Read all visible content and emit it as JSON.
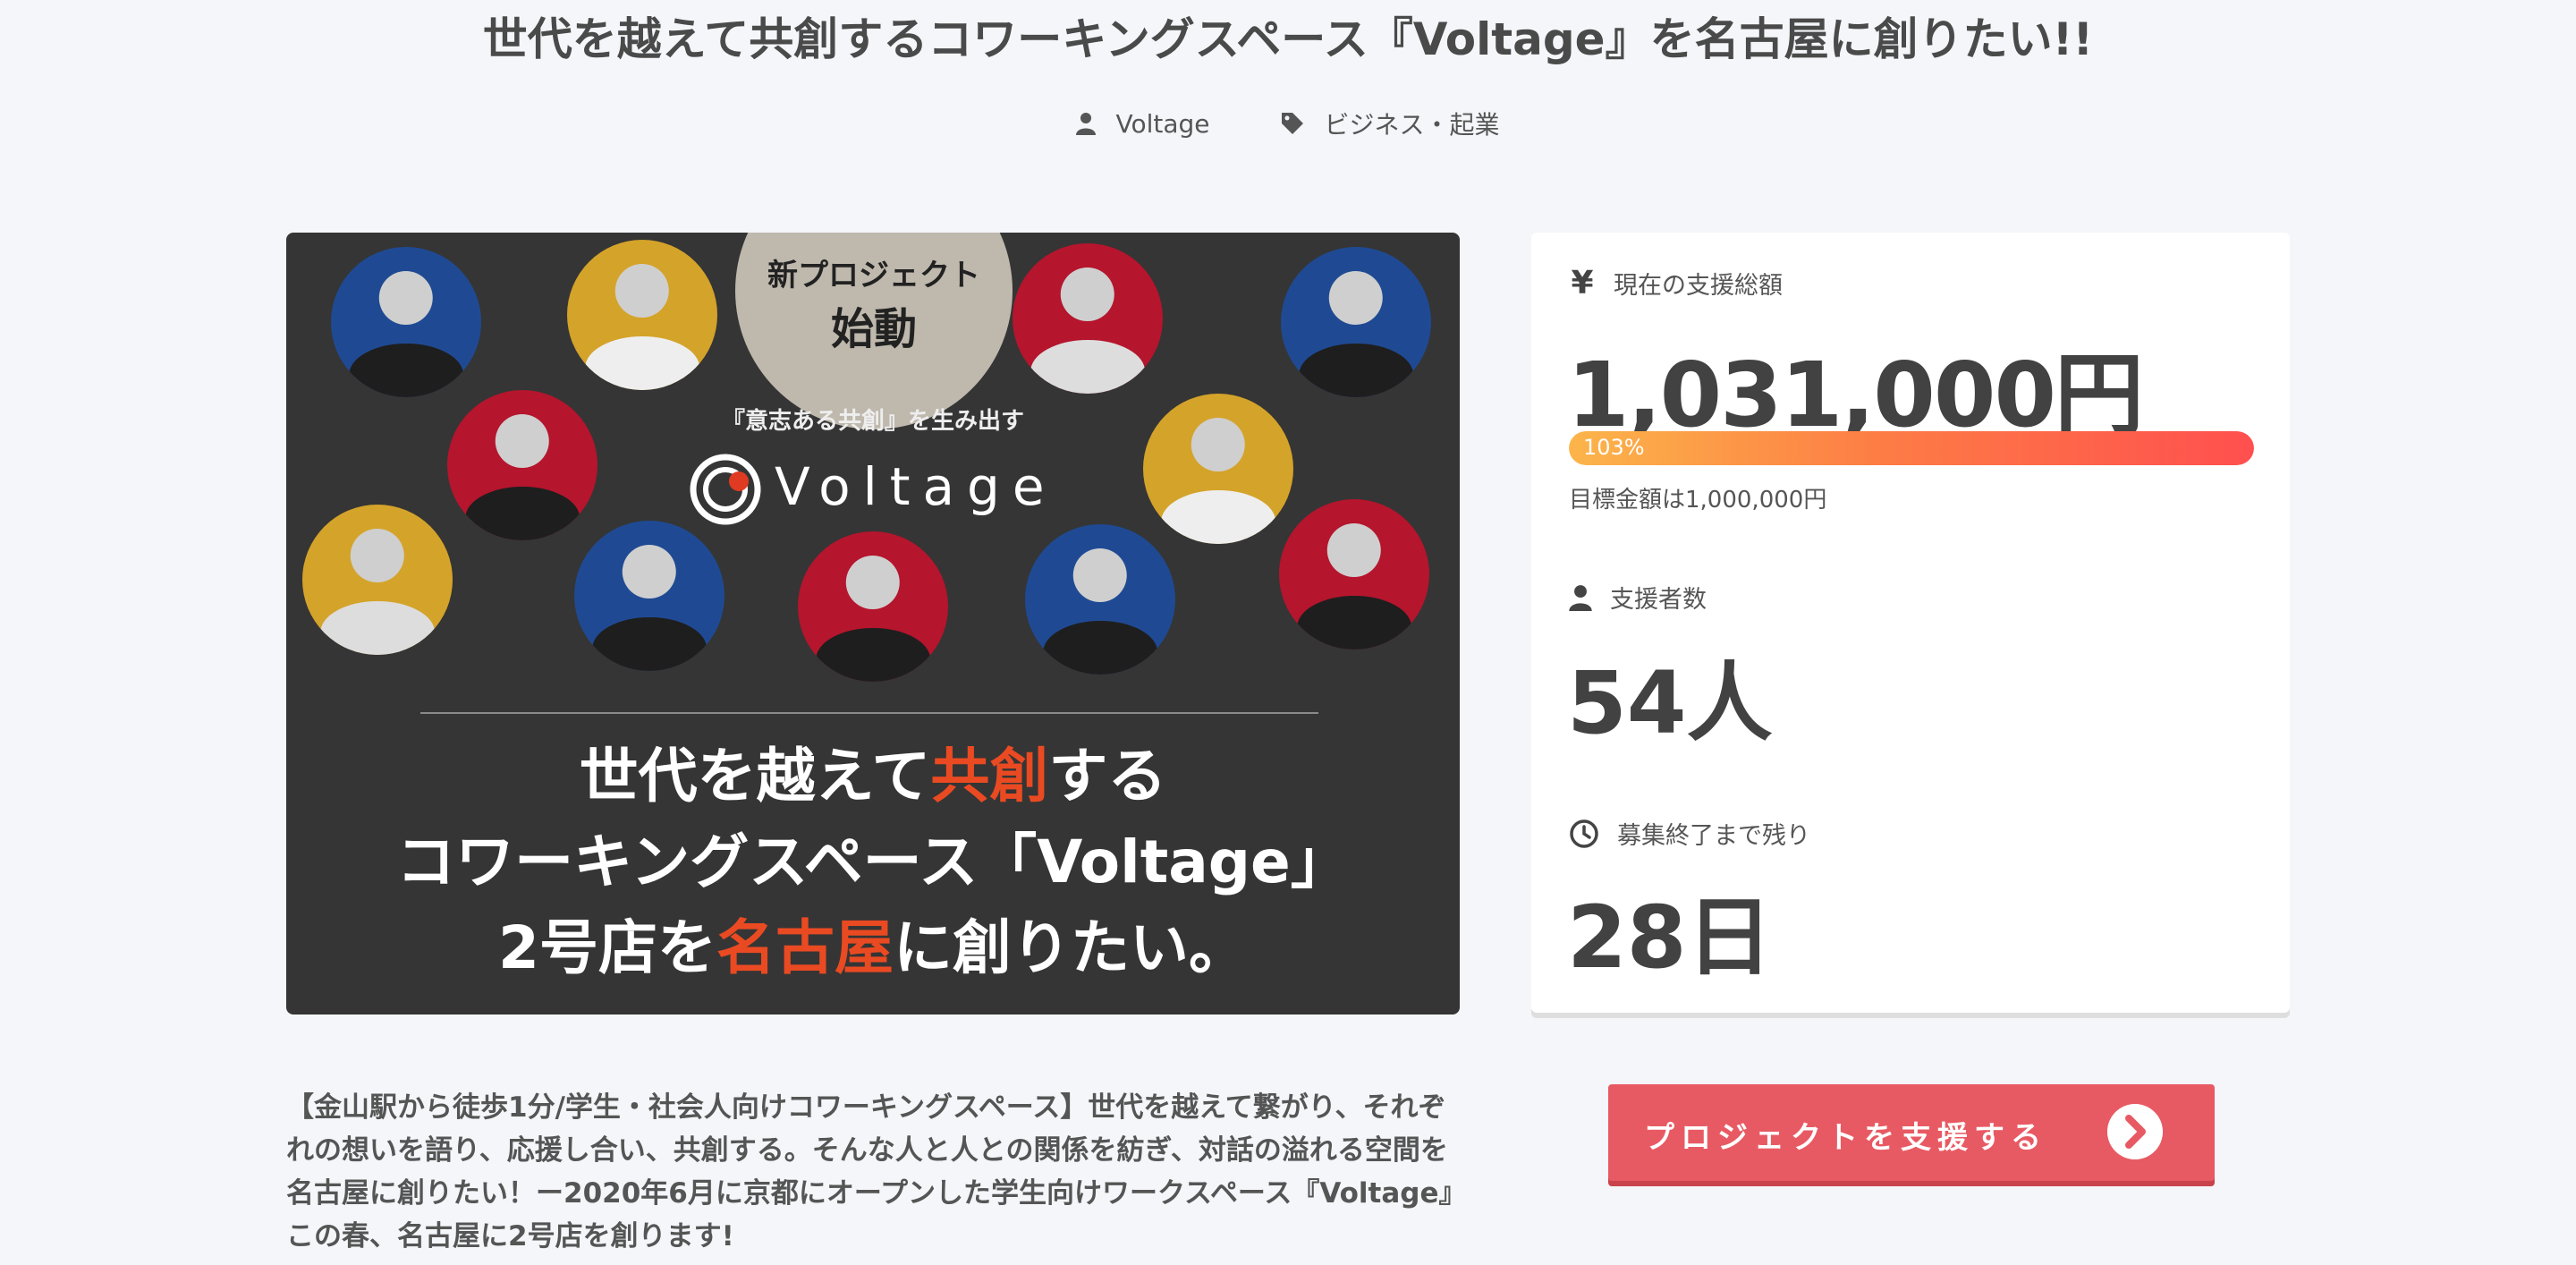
{
  "page": {
    "title": "世代を越えて共創するコワーキングスペース『Voltage』を名古屋に創りたい!!",
    "owner": "Voltage",
    "category": "ビジネス・起業"
  },
  "hero": {
    "badge_line1": "新プロジェクト",
    "badge_line2": "始動",
    "tagline": "『意志ある共創』を生み出す",
    "logo_text": "Voltage",
    "text_l1_a": "世代を越えて",
    "text_l1_hl": "共創",
    "text_l1_b": "する",
    "text_l2": "コワーキングスペース「Voltage」",
    "text_l3_a": "2号店を",
    "text_l3_hl": "名古屋",
    "text_l3_b": "に創りたい。",
    "highlight_color": "#ea4a22"
  },
  "stats": {
    "amount_label": "現在の支援総額",
    "amount_icon": "¥",
    "amount": "1,031,000円",
    "progress_label": "103%",
    "progress_fraction": 1.0,
    "goal_text": "目標金額は1,000,000円",
    "backers_label": "支援者数",
    "backers": "54人",
    "remaining_label": "募集終了まで残り",
    "remaining": "28日"
  },
  "description": "【金山駅から徒歩1分/学生・社会人向けコワーキングスペース】世代を越えて繋がり、それぞれの想いを語り、応援し合い、共創する。そんな人と人との関係を紡ぎ、対話の溢れる空間を名古屋に創りたい！ー2020年6月に京都にオープンした学生向けワークスペース『Voltage』この春、名古屋に2号店を創ります!",
  "cta": {
    "label": "プロジェクトを支援する",
    "color": "#e85a63"
  }
}
